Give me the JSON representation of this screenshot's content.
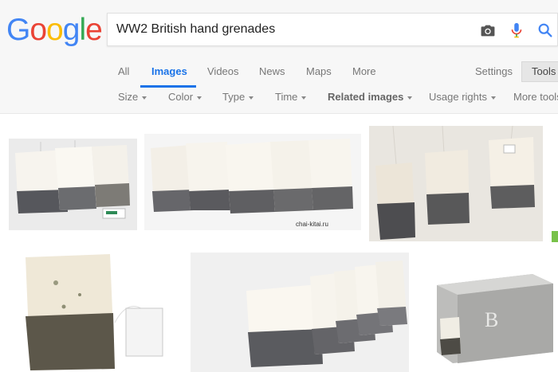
{
  "logo": {
    "letters": [
      "G",
      "o",
      "o",
      "g",
      "l",
      "e"
    ],
    "colors": [
      "#4285F4",
      "#EA4335",
      "#FBBC05",
      "#4285F4",
      "#34A853",
      "#EA4335"
    ]
  },
  "search": {
    "query": "WW2 British hand grenades"
  },
  "icons": {
    "camera": "camera-icon",
    "mic": "microphone-icon",
    "search": "search-icon"
  },
  "tabs": [
    "All",
    "Images",
    "Videos",
    "News",
    "Maps",
    "More"
  ],
  "active_tab": "Images",
  "settings_label": "Settings",
  "tools_label": "Tools",
  "filters": {
    "size": "Size",
    "color": "Color",
    "type": "Type",
    "time": "Time",
    "related": "Related images",
    "usage": "Usage rights",
    "more_tools": "More tools"
  },
  "results": {
    "watermark_1": "chai-kitai.ru"
  },
  "accent_color": "#1a73e8"
}
